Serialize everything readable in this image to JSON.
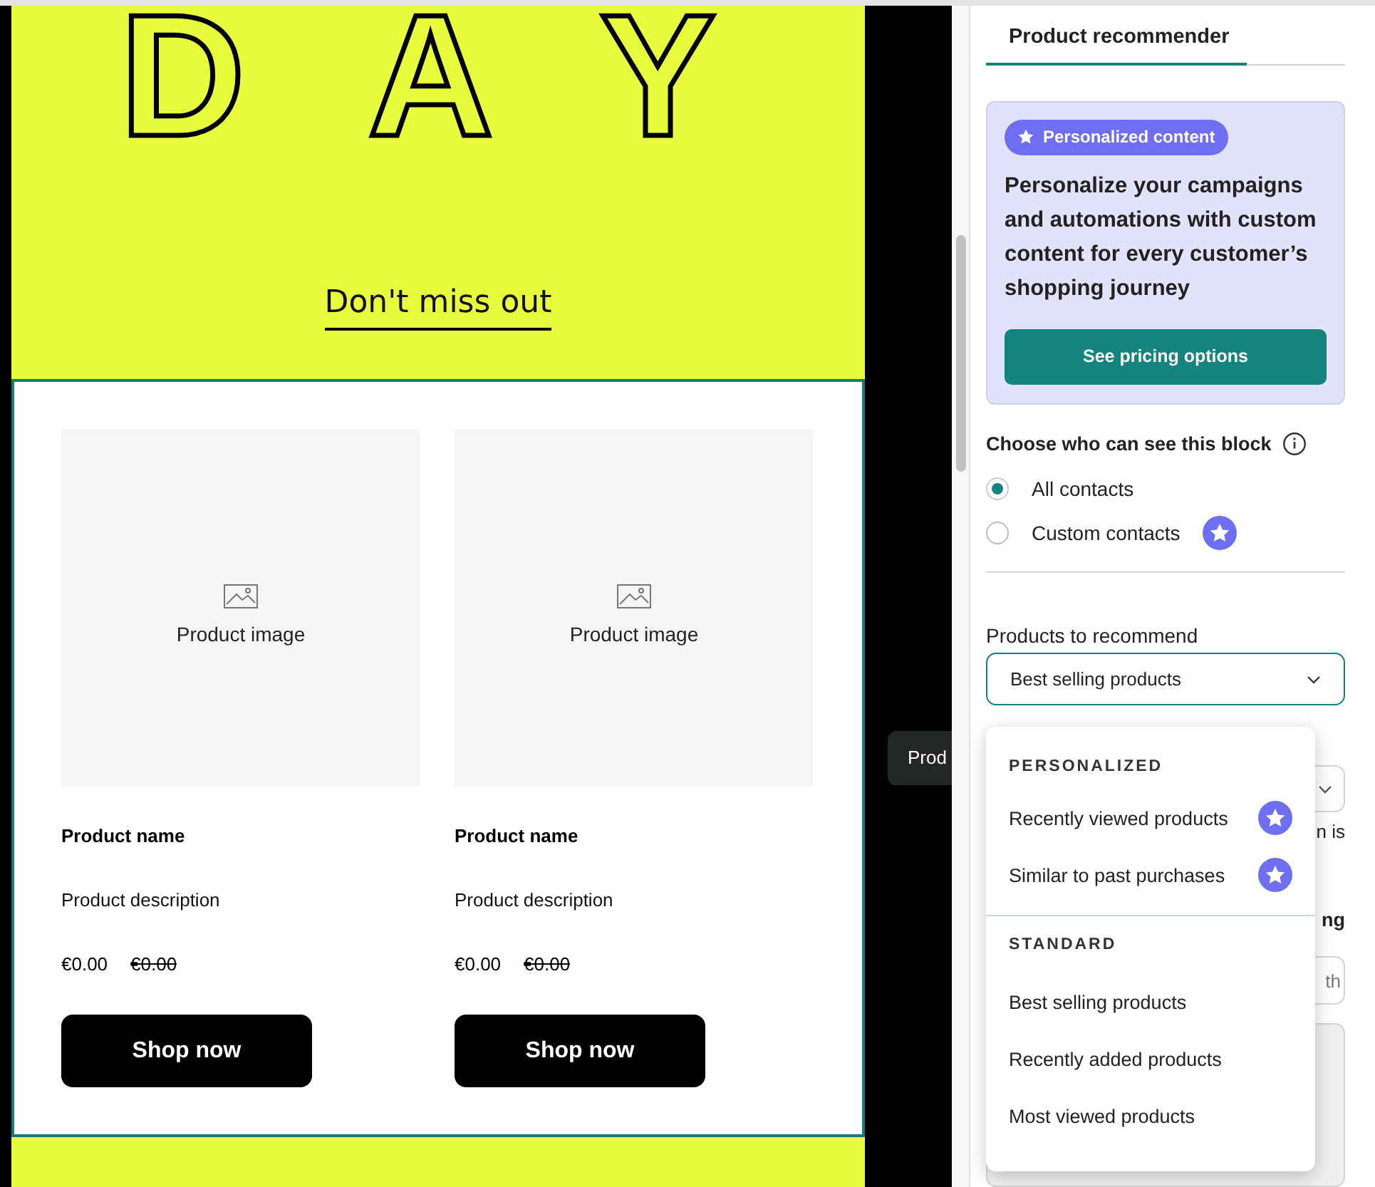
{
  "email_preview": {
    "heading": "DAY",
    "subheading": "Don't miss out",
    "products": [
      {
        "image_label": "Product image",
        "name": "Product name",
        "description": "Product description",
        "price": "€0.00",
        "old_price": "€0.00",
        "button": "Shop now"
      },
      {
        "image_label": "Product image",
        "name": "Product name",
        "description": "Product description",
        "price": "€0.00",
        "old_price": "€0.00",
        "button": "Shop now"
      }
    ]
  },
  "tooltip": {
    "text": "Prod"
  },
  "panel": {
    "tab": {
      "label": "Product recommender",
      "selected": true
    },
    "promo": {
      "badge": "Personalized content",
      "text": "Personalize your campaigns and automations with custom content for every customer’s shopping journey",
      "button": "See pricing options"
    },
    "visibility": {
      "label": "Choose who can see this block",
      "options": [
        {
          "label": "All contacts",
          "selected": true,
          "premium": false
        },
        {
          "label": "Custom contacts",
          "selected": false,
          "premium": true
        }
      ]
    },
    "products_to_recommend": {
      "label": "Products to recommend",
      "value": "Best selling products"
    },
    "covered": {
      "note_end": "n is",
      "heading_end": "ng",
      "field_placeholder_end": "th"
    },
    "dropdown": {
      "groups": [
        {
          "heading": "PERSONALIZED",
          "items": [
            {
              "label": "Recently viewed products",
              "premium": true
            },
            {
              "label": "Similar to past purchases",
              "premium": true
            }
          ]
        },
        {
          "heading": "STANDARD",
          "items": [
            {
              "label": "Best selling products",
              "premium": false
            },
            {
              "label": "Recently added products",
              "premium": false
            },
            {
              "label": "Most viewed products",
              "premium": false
            }
          ]
        }
      ]
    }
  }
}
